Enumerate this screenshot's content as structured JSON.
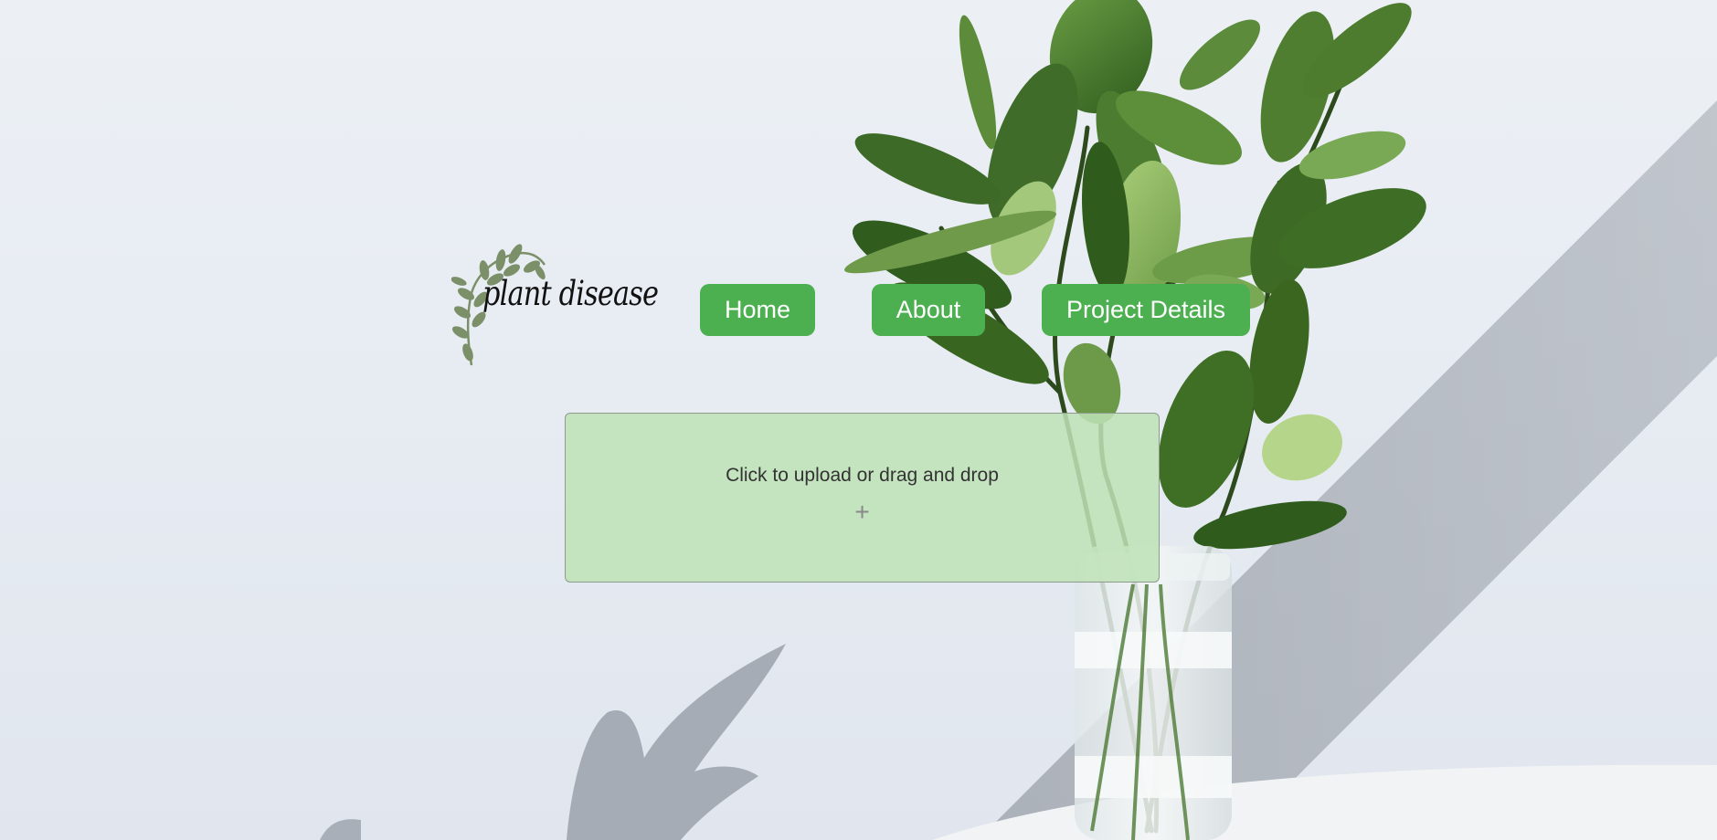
{
  "logo": {
    "text": "plant disease",
    "icon": "leaf-sprig-icon"
  },
  "nav": {
    "home": "Home",
    "about": "About",
    "project_details": "Project Details"
  },
  "upload": {
    "prompt": "Click to upload or drag and drop",
    "plus_symbol": "+",
    "icon": "plus-icon"
  },
  "colors": {
    "accent": "#4caf50",
    "upload_bg": "#c6e5c0",
    "leaf": "#4a7a2c",
    "logo_leaf": "#7b8f68",
    "background": "#e9edf3"
  }
}
